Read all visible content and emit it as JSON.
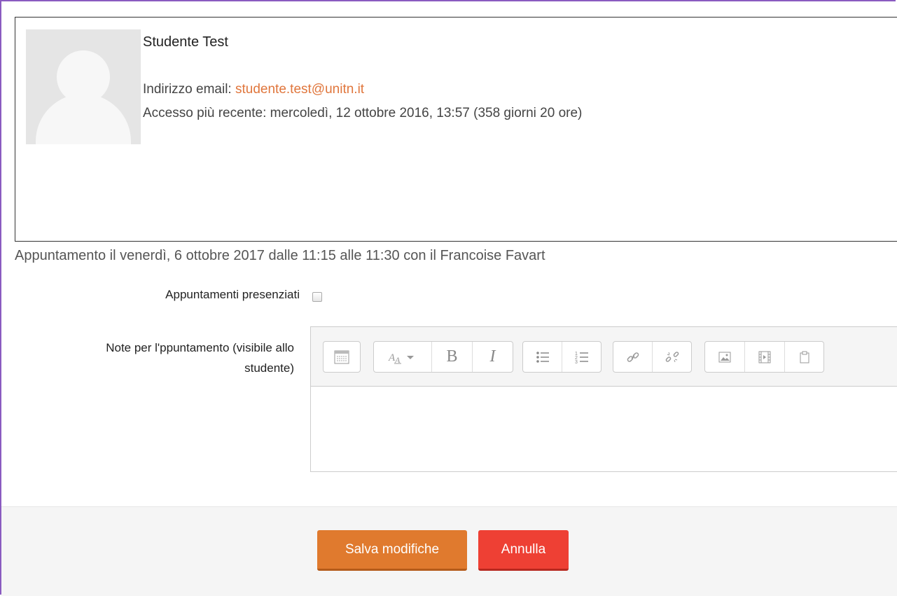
{
  "profile": {
    "name": "Studente Test",
    "email_label": "Indirizzo email: ",
    "email": "studente.test@unitn.it",
    "last_access": "Accesso più recente: mercoledì, 12 ottobre 2016, 13:57  (358 giorni 20 ore)"
  },
  "appointment": {
    "summary": "Appuntamento il venerdì, 6 ottobre 2017 dalle 11:15 alle 11:30 con il Francoise Favart"
  },
  "form": {
    "attended_label": "Appuntamenti presenziati",
    "attended_checked": false,
    "notes_label_line1": "Note per l'ppuntamento (visibile allo",
    "notes_label_line2": "studente)",
    "notes_value": ""
  },
  "toolbar": {
    "icons": [
      "toolbar-toggle-icon",
      "font-style-icon",
      "bold-icon",
      "italic-icon",
      "bullet-list-icon",
      "numbered-list-icon",
      "link-icon",
      "unlink-icon",
      "image-icon",
      "media-icon",
      "manage-files-icon"
    ]
  },
  "buttons": {
    "save": "Salva modifiche",
    "cancel": "Annulla"
  },
  "colors": {
    "accent_orange": "#e07a2e",
    "cancel_red": "#ee4034",
    "link": "#e0763c",
    "frame": "#8a5bc0"
  }
}
